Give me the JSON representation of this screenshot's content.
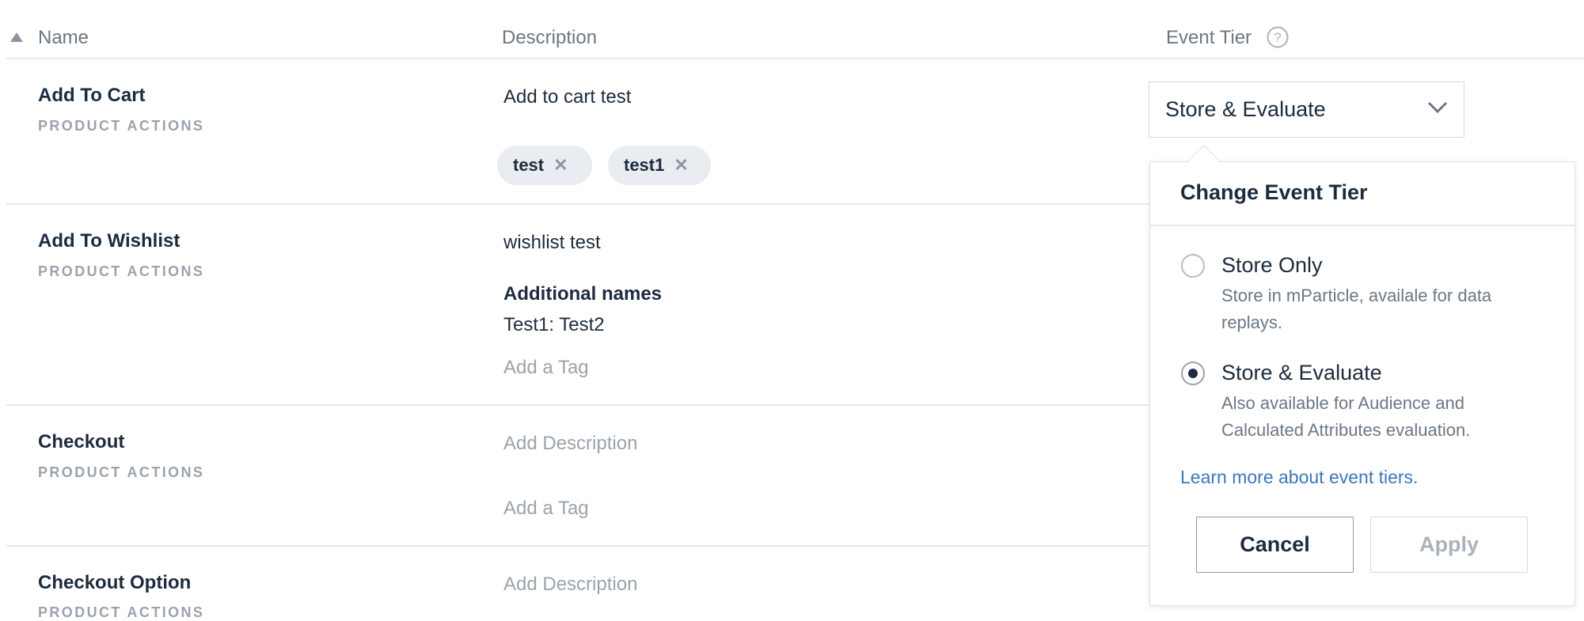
{
  "table": {
    "headers": {
      "name": "Name",
      "description": "Description",
      "event_tier": "Event Tier"
    },
    "rows": [
      {
        "name": "Add To Cart",
        "category": "PRODUCT ACTIONS",
        "description": "Add to cart test",
        "tags": [
          "test",
          "test1"
        ]
      },
      {
        "name": "Add To Wishlist",
        "category": "PRODUCT ACTIONS",
        "description": "wishlist test",
        "additional_names_label": "Additional names",
        "additional_names_value": "Test1: Test2",
        "add_tag": "Add a Tag"
      },
      {
        "name": "Checkout",
        "category": "PRODUCT ACTIONS",
        "add_description": "Add Description",
        "add_tag": "Add a Tag"
      },
      {
        "name": "Checkout Option",
        "category": "PRODUCT ACTIONS",
        "add_description": "Add Description"
      }
    ]
  },
  "tier_select": {
    "value": "Store & Evaluate"
  },
  "popover": {
    "title": "Change Event Tier",
    "options": [
      {
        "label": "Store Only",
        "desc_line1": "Store in mParticle, availale for data",
        "desc_line2": "replays.",
        "selected": false
      },
      {
        "label": "Store & Evaluate",
        "desc_line1": "Also available for Audience and",
        "desc_line2": "Calculated Attributes evaluation.",
        "selected": true
      }
    ],
    "link": "Learn more about event tiers.",
    "cancel": "Cancel",
    "apply": "Apply"
  },
  "colors": {
    "text": "#1c2b3d",
    "muted": "#9aa3ad",
    "link": "#3b78b8"
  },
  "icons": {
    "sort": "sort-up-icon",
    "help": "help-circle-icon",
    "chevron": "chevron-down-icon",
    "remove": "close-icon"
  }
}
